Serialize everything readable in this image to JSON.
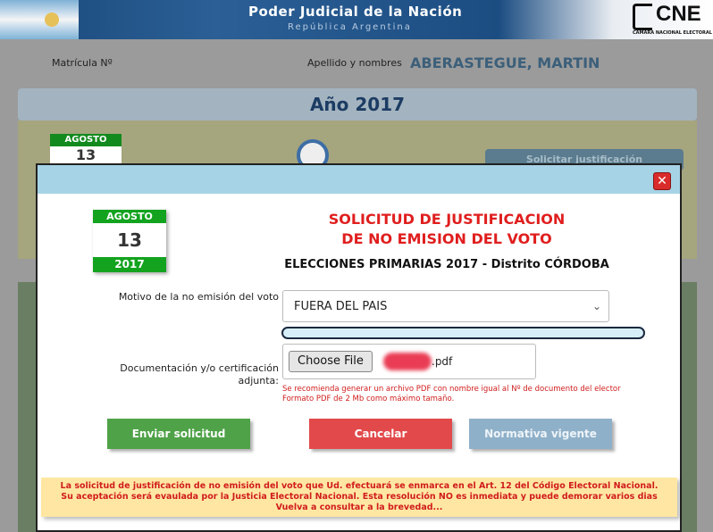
{
  "header": {
    "title": "Poder Judicial de la Nación",
    "subtitle": "República Argentina",
    "logo_text": "CNE",
    "logo_subtitle": "CÁMARA NACIONAL ELECTORAL"
  },
  "person": {
    "matricula_label": "Matrícula Nº",
    "apellido_label": "Apellido y nombres",
    "apellido_value": "ABERASTEGUE, MARTIN"
  },
  "background": {
    "year_title": "Año 2017",
    "cal_month": "AGOSTO",
    "cal_day": "13",
    "button_label": "Solicitar justificación"
  },
  "modal": {
    "calendar": {
      "month": "AGOSTO",
      "day": "13",
      "year": "2017"
    },
    "title_line1": "SOLICITUD DE JUSTIFICACION",
    "title_line2": "DE NO EMISION DEL VOTO",
    "elecciones": "ELECCIONES PRIMARIAS 2017  -  Distrito CÓRDOBA",
    "motivo_label": "Motivo de la no emisión del voto",
    "motivo_value": "FUERA DEL PAIS",
    "documentacion_label": "Documentación y/o certificación adjunta:",
    "file_button": "Choose File",
    "file_name": ".pdf",
    "hint_line1": "Se recomienda generar un archivo PDF con nombre igual al Nº de documento del elector",
    "hint_line2": "Formato PDF de 2 Mb como máximo tamaño.",
    "btn_send": "Enviar solicitud",
    "btn_cancel": "Cancelar",
    "btn_normativa": "Normativa vigente",
    "notice_line1": "La solicitud de justificación de no emisión del voto que Ud. efectuará se enmarca en el Art. 12 del Código Electoral Nacional.",
    "notice_line2": "Su aceptación será evaulada por la Justicia Electoral Nacional. Esta resolución NO es inmediata y puede demorar varios dias",
    "notice_line3": "Vuelva a consultar a la brevedad...",
    "close_symbol": "✕"
  },
  "colors": {
    "accent_red": "#e01e1e",
    "calendar_green": "#13a31f",
    "send_green": "#4fa247",
    "cancel_red": "#e2494b",
    "normativa_blue": "#8fb0c9",
    "modal_header": "#a6d3e6",
    "notice_bg": "#ffe7a3"
  },
  "icons": {
    "close": "close-icon",
    "dropdown": "chevron-down-icon",
    "gauge": "gauge-icon"
  }
}
